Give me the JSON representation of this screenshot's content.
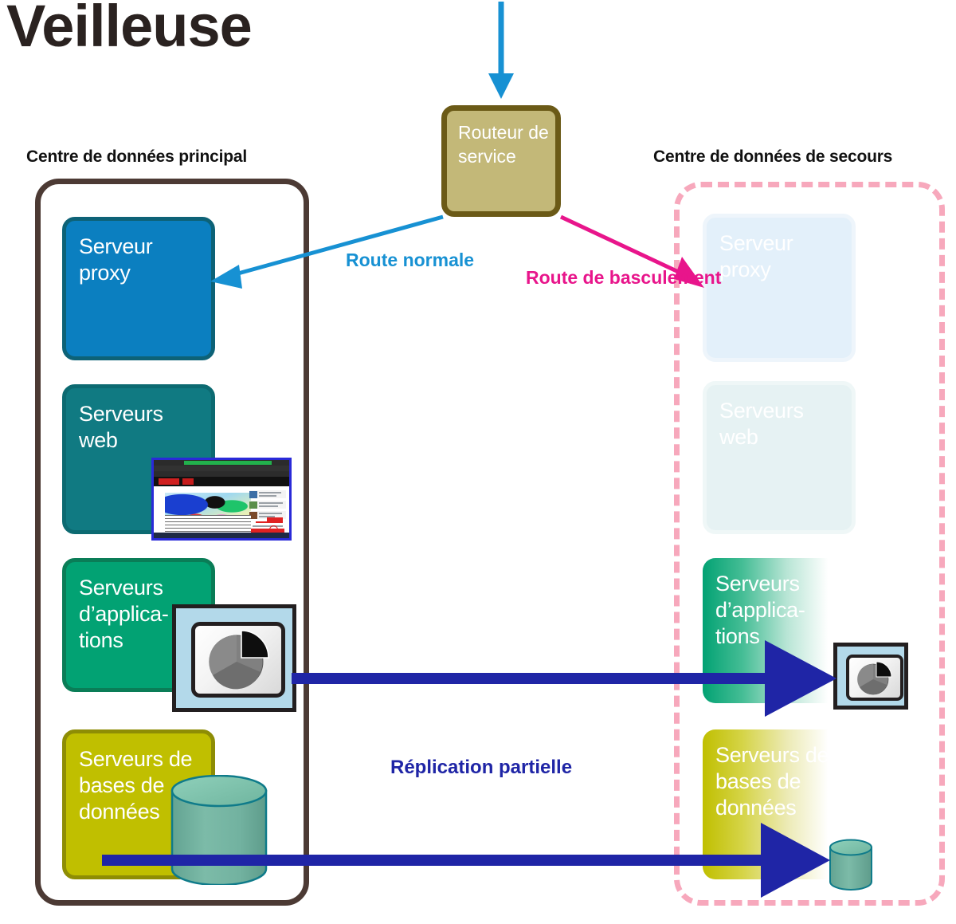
{
  "title": "Veilleuse",
  "headings": {
    "primary_datacenter": "Centre de données principal",
    "backup_datacenter": "Centre de données de secours"
  },
  "router": {
    "line1": "Routeur",
    "line2": "de service"
  },
  "route_labels": {
    "normal_line1": "Route",
    "normal_line2": "normale",
    "failover_line1": "Route de",
    "failover_line2": "basculement",
    "replication": "Réplication partielle"
  },
  "primary_servers": [
    {
      "name": "proxy-server",
      "line1": "Serveur",
      "line2": "proxy",
      "line3": "",
      "color": "#0b7fc0",
      "border": "#0d6277"
    },
    {
      "name": "web-servers",
      "line1": "Serveurs",
      "line2": "web",
      "line3": "",
      "color": "#107a82",
      "border": "#0c6a71"
    },
    {
      "name": "application-servers",
      "line1": "Serveurs",
      "line2": "d’applica-",
      "line3": "tions",
      "color": "#02a273",
      "border": "#0a7d57"
    },
    {
      "name": "database-servers",
      "line1": "Serveurs de",
      "line2": "bases de",
      "line3": "données",
      "color": "#c0bf00",
      "border": "#8e8d05"
    }
  ],
  "backup_servers": [
    {
      "name": "proxy-server-backup",
      "line1": "Serveur",
      "line2": "proxy",
      "line3": "",
      "state": "faded"
    },
    {
      "name": "web-servers-backup",
      "line1": "Serveurs",
      "line2": "web",
      "line3": "",
      "state": "faded"
    },
    {
      "name": "application-servers-backup",
      "line1": "Serveurs",
      "line2": "d’applica-",
      "line3": "tions",
      "state": "fading-gradient"
    },
    {
      "name": "database-servers-backup",
      "line1": "Serveurs de",
      "line2": "bases de",
      "line3": "données",
      "state": "fading-gradient"
    }
  ],
  "colors": {
    "title": "#2a2220",
    "router_fill": "#c3b878",
    "router_border": "#6b5a17",
    "normal_route": "#1791d3",
    "failover_route": "#e8158b",
    "replication_arrow": "#1f25a6",
    "primary_border": "#4c3a34",
    "backup_border": "#f7a8bc",
    "cylinder_fill": "#74b8a4",
    "cylinder_stroke": "#0f7b8a",
    "pie_panel": "#b3d9ea"
  },
  "icons": {
    "pie_chart_monitor": "pie-chart-monitor-icon",
    "database_cylinder": "database-cylinder-icon",
    "browser_window": "browser-window-icon"
  }
}
